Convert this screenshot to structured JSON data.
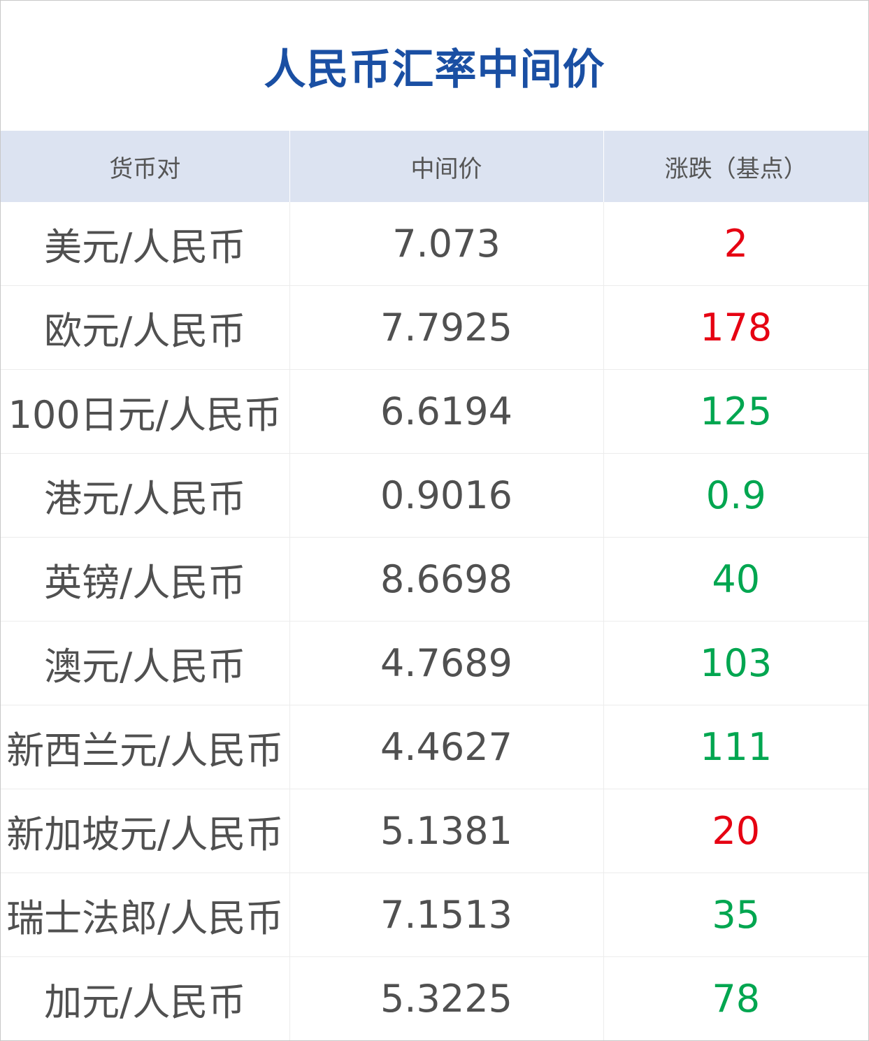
{
  "title": "人民币汇率中间价",
  "colors": {
    "title": "#1a4fa3",
    "header_bg": "#dce3f1",
    "text": "#505050",
    "up": "#e60012",
    "down": "#00a650"
  },
  "table": {
    "headers": [
      "货币对",
      "中间价",
      "涨跌（基点）"
    ],
    "rows": [
      {
        "pair": "美元/人民币",
        "rate": "7.073",
        "change": "2",
        "direction": "up"
      },
      {
        "pair": "欧元/人民币",
        "rate": "7.7925",
        "change": "178",
        "direction": "up"
      },
      {
        "pair": "100日元/人民币",
        "rate": "6.6194",
        "change": "125",
        "direction": "down"
      },
      {
        "pair": "港元/人民币",
        "rate": "0.9016",
        "change": "0.9",
        "direction": "down"
      },
      {
        "pair": "英镑/人民币",
        "rate": "8.6698",
        "change": "40",
        "direction": "down"
      },
      {
        "pair": "澳元/人民币",
        "rate": "4.7689",
        "change": "103",
        "direction": "down"
      },
      {
        "pair": "新西兰元/人民币",
        "rate": "4.4627",
        "change": "111",
        "direction": "down"
      },
      {
        "pair": "新加坡元/人民币",
        "rate": "5.1381",
        "change": "20",
        "direction": "up"
      },
      {
        "pair": "瑞士法郎/人民币",
        "rate": "7.1513",
        "change": "35",
        "direction": "down"
      },
      {
        "pair": "加元/人民币",
        "rate": "5.3225",
        "change": "78",
        "direction": "down"
      }
    ]
  }
}
